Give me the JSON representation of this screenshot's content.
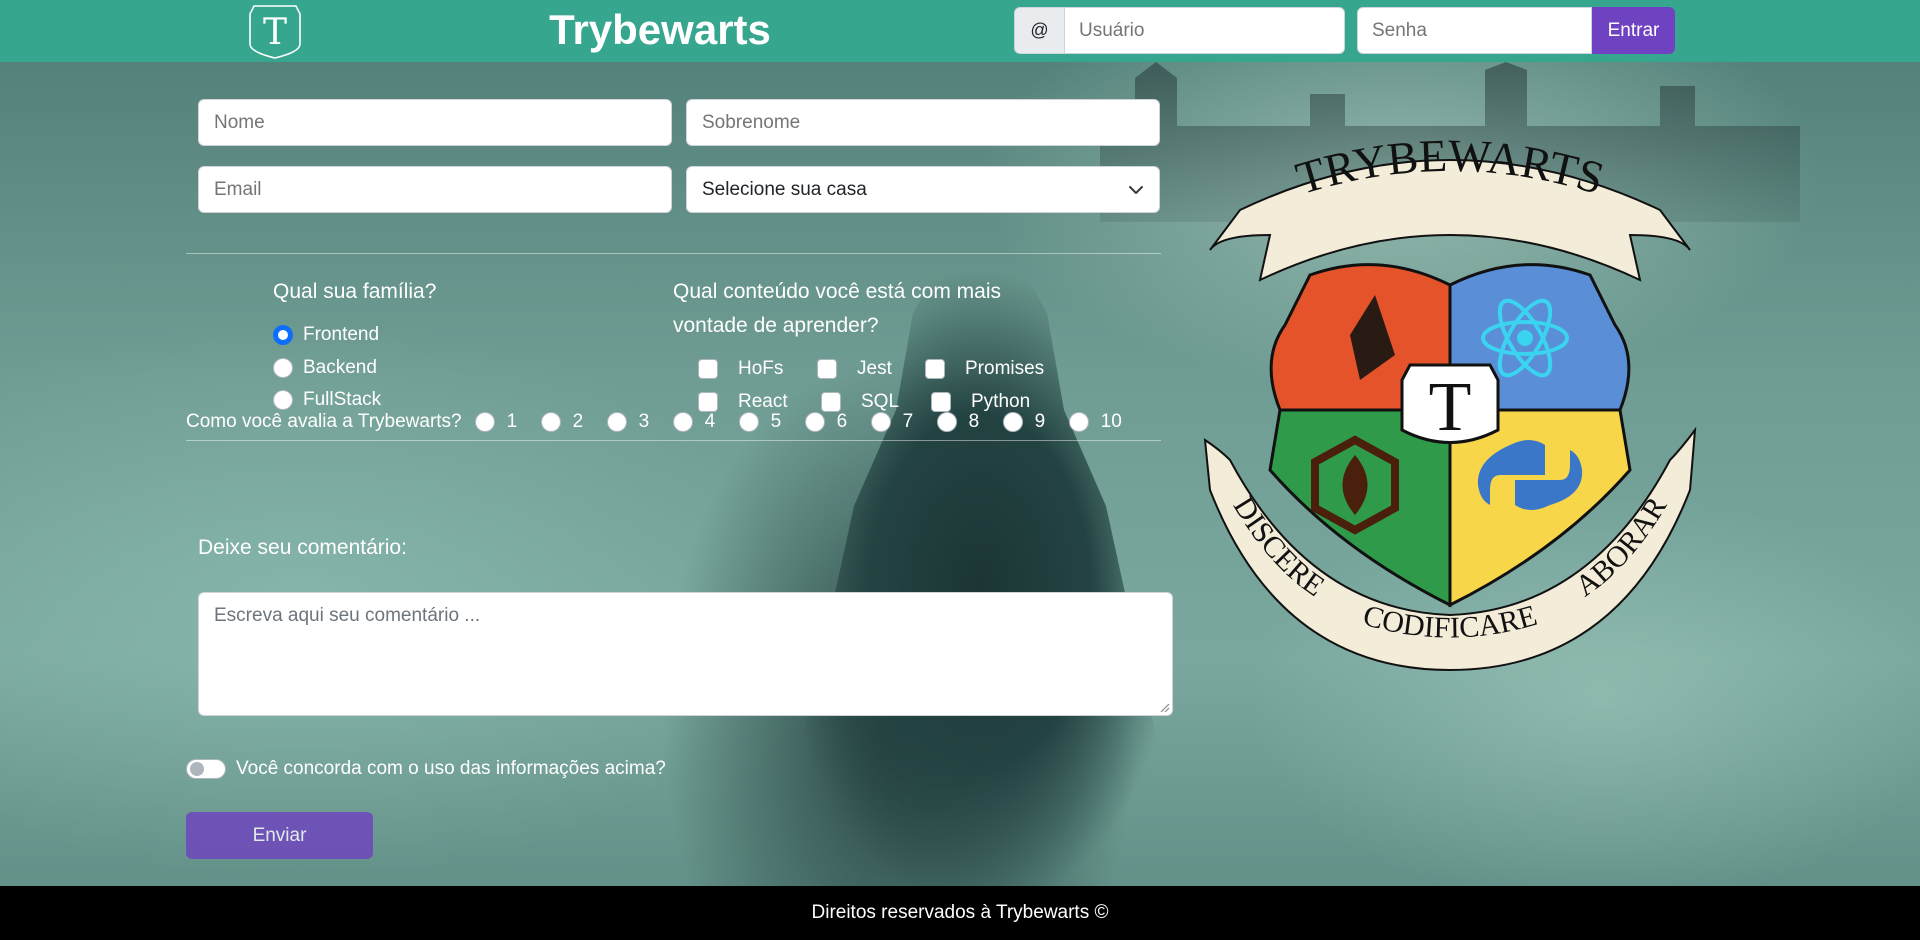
{
  "header": {
    "logo_letter": "T",
    "title": "Trybewarts",
    "login": {
      "at_symbol": "@",
      "user_placeholder": "Usuário",
      "password_placeholder": "Senha",
      "enter_label": "Entrar"
    }
  },
  "form": {
    "name_placeholder": "Nome",
    "surname_placeholder": "Sobrenome",
    "email_placeholder": "Email",
    "house_select_value": "Selecione sua casa",
    "family": {
      "question": "Qual sua família?",
      "options": [
        {
          "label": "Frontend",
          "checked": true
        },
        {
          "label": "Backend",
          "checked": false
        },
        {
          "label": "FullStack",
          "checked": false
        }
      ]
    },
    "content": {
      "question_line1": "Qual conteúdo você está com mais",
      "question_line2": "vontade de aprender?",
      "options": [
        "HoFs",
        "Jest",
        "Promises",
        "React",
        "SQL",
        "Python"
      ]
    },
    "rating": {
      "question": "Como você avalia a Trybewarts?",
      "options": [
        "1",
        "2",
        "3",
        "4",
        "5",
        "6",
        "7",
        "8",
        "9",
        "10"
      ]
    },
    "comment_label": "Deixe seu comentário:",
    "comment_placeholder": "Escreva aqui seu comentário ...",
    "agreement_label": "Você concorda com o uso das informações acima?",
    "submit_label": "Enviar"
  },
  "crest": {
    "top_banner": "TRYBEWARTS",
    "center_letter": "T",
    "left_banner": "DISCERE",
    "bottom_banner": "CODIFICARE",
    "right_banner": "LABORARE",
    "colors": {
      "red": "#e4532a",
      "blue": "#5a8fd8",
      "green": "#2f9a4a",
      "yellow": "#f8d649",
      "ribbon": "#f3ecd9"
    }
  },
  "footer": {
    "text": "Direitos reservados à Trybewarts ©"
  },
  "colors": {
    "header_bg": "#36a68f",
    "button_purple": "#6f42c1",
    "radio_checked": "#0d6efd",
    "footer_bg": "#000000"
  }
}
